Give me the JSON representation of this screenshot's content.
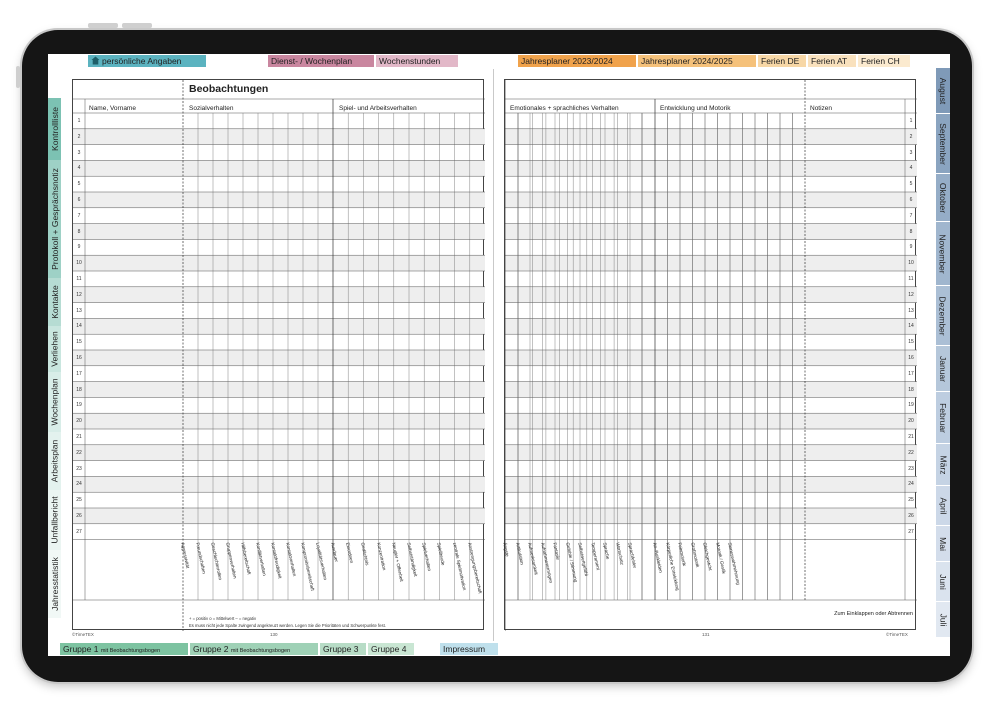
{
  "top_tabs": [
    {
      "label": "persönliche Angaben",
      "color": "#5bb3c0"
    },
    {
      "label": "Dienst- / Wochenplan",
      "color": "#c9869f"
    },
    {
      "label": "Wochenstunden",
      "color": "#e2b8c8"
    },
    {
      "label": "Jahresplaner 2023/2024",
      "color": "#f0a24b"
    },
    {
      "label": "Jahresplaner 2024/2025",
      "color": "#f5c17a"
    },
    {
      "label": "Ferien DE",
      "color": "#f7d7a6"
    },
    {
      "label": "Ferien AT",
      "color": "#f9e1bd"
    },
    {
      "label": "Ferien CH",
      "color": "#fbeacf"
    }
  ],
  "left_tabs": [
    "Kontrollliste",
    "Protokoll + Gesprächsnotiz",
    "Kontakte",
    "Verliehen",
    "Wochenplan",
    "Arbeitsplan",
    "Unfallbericht",
    "Jahresstatistik"
  ],
  "right_tabs": [
    "August",
    "September",
    "Oktober",
    "November",
    "Dezember",
    "Januar",
    "Februar",
    "März",
    "April",
    "Mai",
    "Juni",
    "Juli"
  ],
  "bottom_tabs": [
    {
      "label": "Gruppe 1",
      "sub": "mit Beobachtungsbogen",
      "color": "#7dc3a1"
    },
    {
      "label": "Gruppe 2",
      "sub": "mit Beobachtungsbogen",
      "color": "#9fd1b6"
    },
    {
      "label": "Gruppe 3",
      "sub": "",
      "color": "#b7dcc6"
    },
    {
      "label": "Gruppe 4",
      "sub": "",
      "color": "#c9e6d3"
    },
    {
      "label": "Impressum",
      "sub": "",
      "color": "#bfe0ec"
    }
  ],
  "left_page": {
    "title": "Beobachtungen",
    "col_name": "Name, Vorname",
    "col_social": "Sozialverhalten",
    "col_play": "Spiel- und Arbeitsverhalten",
    "social_items": [
      "Aggressivität",
      "Freundschaften",
      "Geschlechterrollen",
      "Gruppenverhalten",
      "Hilfsbereitschaft",
      "Konfliktverhalten",
      "Kontaktfreudigkeit",
      "Kontaktverhalten",
      "Kompromissbereitschaft",
      "Loyalitätsverhalten"
    ],
    "play_items": [
      "Ausdauer",
      "Einordnen",
      "Gedächtnis",
      "Konzentration",
      "Neugier + Offenheit",
      "Selbstständigkeit",
      "Spielverhalten",
      "Spielfreude",
      "zentrale Spielmotivation",
      "Anstrengungsbereitschaft"
    ],
    "legend": "+ = positiv    o = Mittelwert    – = negativ",
    "legend2": "Es muss nicht jede Spalte zwingend angekreuzt werden. Legen Sie die Prioritäten und Schwerpunkte fest.",
    "footer_left": "©TimeTEX",
    "page_number": "130"
  },
  "right_page": {
    "col_emotional": "Emotionales + sprachliches Verhalten",
    "col_motor": "Entwicklung und Motorik",
    "col_notes": "Notizen",
    "emotional_items": [
      "Ängste",
      "Artikulation",
      "Aufmerksamkeit",
      "Aufnahmevermögen",
      "Fantasie",
      "Gefühle / Stimmung",
      "Selbstwertgefühl",
      "Temperament",
      "Sprache",
      "Wortschatz",
      "Sprachfehler"
    ],
    "motor_items": [
      "An-/Auskleiden",
      "Körperliche Entwicklung",
      "Feinmotorik",
      "Grobmotorik",
      "Gleichgewicht",
      "Motorik / Gestik",
      "Sinneswahrnehmung"
    ],
    "fold_note": "Zum Einklappen oder Abtrennen",
    "footer_right": "©TimeTEX",
    "page_number": "131"
  },
  "row_numbers": [
    "1",
    "2",
    "3",
    "4",
    "5",
    "6",
    "7",
    "8",
    "9",
    "10",
    "11",
    "12",
    "13",
    "14",
    "15",
    "16",
    "17",
    "18",
    "19",
    "20",
    "21",
    "22",
    "23",
    "24",
    "25",
    "26",
    "27"
  ]
}
